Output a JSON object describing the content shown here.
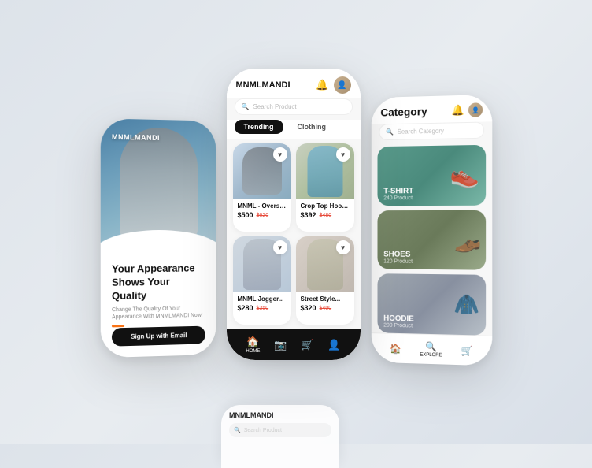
{
  "app": {
    "brand": "MNMLMANDI",
    "tagline": "Your Appearance Shows Your Quality",
    "sub_tagline": "Change The Quality Of Your Appearance With MNMLMANDI Now!",
    "signup_btn": "Sign Up with Email"
  },
  "middle_screen": {
    "brand": "MNMLMANDI",
    "search_placeholder": "Search Product",
    "tab_trending": "Trending",
    "tab_clothing": "Clothing",
    "products": [
      {
        "name": "MNML - Oversi...",
        "price": "$500",
        "old_price": "$620",
        "img_class": "product-img-1"
      },
      {
        "name": "Crop Top Hoodie J...",
        "price": "$392",
        "old_price": "$480",
        "img_class": "product-img-2"
      },
      {
        "name": "MNML Jogger...",
        "price": "$280",
        "old_price": "$350",
        "img_class": "product-img-3"
      },
      {
        "name": "Street Style...",
        "price": "$320",
        "old_price": "$400",
        "img_class": "product-img-4"
      }
    ],
    "nav": [
      {
        "label": "HOME",
        "icon": "🏠"
      },
      {
        "label": "",
        "icon": "📷"
      },
      {
        "label": "",
        "icon": "🛒"
      },
      {
        "label": "",
        "icon": "👤"
      }
    ]
  },
  "right_screen": {
    "title": "Category",
    "search_placeholder": "Search Category",
    "categories": [
      {
        "name": "T-SHIRT",
        "count": "240 Product",
        "bg": "cat-bg-tshirt"
      },
      {
        "name": "SHOES",
        "count": "120 Product",
        "bg": "cat-bg-shoes"
      },
      {
        "name": "HOODIE",
        "count": "200 Product",
        "bg": "cat-bg-hoodie"
      }
    ],
    "nav": [
      {
        "label": "",
        "icon": "🏠",
        "active": false
      },
      {
        "label": "EXPLORE",
        "icon": "🔍",
        "active": true
      },
      {
        "label": "",
        "icon": "🛒",
        "active": false
      }
    ]
  },
  "colors": {
    "accent": "#f97316",
    "dark": "#111111",
    "mid_gray": "#888888",
    "light_bg": "#f7f7f7"
  }
}
